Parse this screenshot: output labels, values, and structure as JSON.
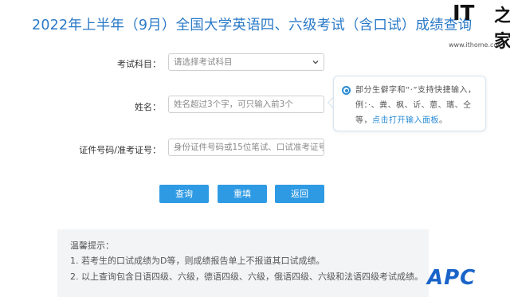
{
  "page": {
    "title": "2022年上半年（9月）全国大学英语四、六级考试（含口试）成绩查询"
  },
  "watermark": {
    "brand": "IT",
    "brand_cn": "之家",
    "url": "www.ithome.com"
  },
  "form": {
    "subject_label": "考试科目：",
    "subject_value": "请选择考试科目",
    "name_label": "姓名：",
    "name_placeholder": "姓名超过3个字，可只输入前3个",
    "id_label": "证件号码/准考证号：",
    "id_placeholder": "身份证件号码或15位笔试、口试准考证号"
  },
  "tip": {
    "text": "部分生僻字和“·”支持快捷输入，例：·、粪、枫、䜣、葸、瓗、仝等，",
    "link": "点击打开输入面板",
    "end": "。"
  },
  "buttons": {
    "query": "查询",
    "reset": "重填",
    "back": "返回"
  },
  "notice": {
    "heading": "温馨提示：",
    "line1": "1. 若考生的口试成绩为D等，则成绩报告单上不报道其口试成绩。",
    "line2": "2. 以上查询包含日语四级、六级，德语四级、六级，俄语四级、六级和法语四级考试成绩。"
  },
  "corner_logo": {
    "text": "APC"
  },
  "colors": {
    "title": "#2a79c7",
    "button": "#2e9ae4",
    "link": "#2a8cd6",
    "notice_bg": "#f3f4f6"
  }
}
